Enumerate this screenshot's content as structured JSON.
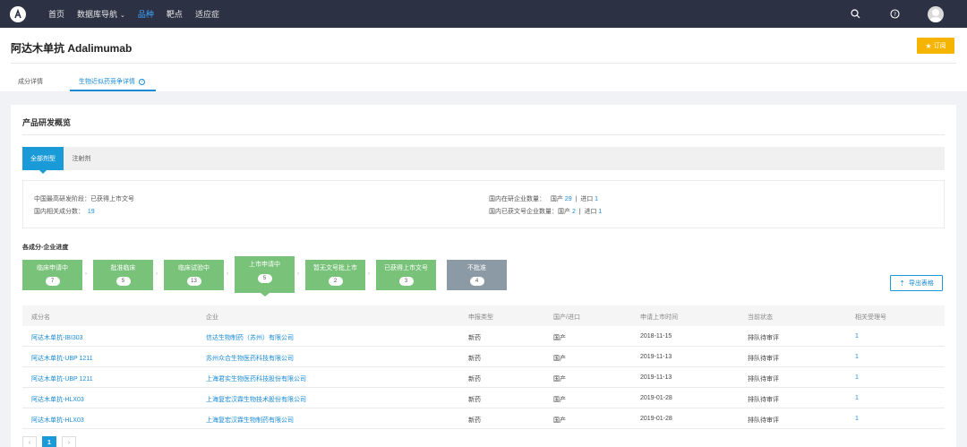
{
  "topbar": {
    "home": "首页",
    "db_nav": "数据库导航",
    "tabs": [
      "品种",
      "靶点",
      "适应症"
    ]
  },
  "header": {
    "title": "阿达木单抗 Adalimumab",
    "subscribe": "订阅",
    "tabs": [
      "成分详情",
      "生物近似药竞争详情"
    ]
  },
  "overview": {
    "title": "产品研发概览",
    "type_tabs": [
      "全部剂型",
      "注射剂"
    ],
    "info": {
      "highest_stage_label": "中国最高研发阶段：",
      "highest_stage_value": "已获得上市文号",
      "related_count_label": "国内相关成分数：",
      "related_count_value": "19",
      "in_dev_label": "国内在研企业数量：",
      "in_dev_domestic_label": "国产",
      "in_dev_domestic_value": "29",
      "in_dev_import_label": "进口",
      "in_dev_import_value": "1",
      "approved_label": "国内已获文号企业数量：",
      "approved_domestic_label": "国产",
      "approved_domestic_value": "2",
      "approved_import_label": "进口",
      "approved_import_value": "1",
      "sep": "|"
    },
    "progress_title": "各成分-企业进度",
    "stages": [
      {
        "label": "临床申请中",
        "count": "7"
      },
      {
        "label": "批准临床",
        "count": "5"
      },
      {
        "label": "临床试验中",
        "count": "13"
      },
      {
        "label": "上市申请中",
        "count": "5"
      },
      {
        "label": "暂无文号批上市",
        "count": "2"
      },
      {
        "label": "已获得上市文号",
        "count": "3"
      },
      {
        "label": "不批准",
        "count": "4"
      }
    ],
    "export": "导出表格"
  },
  "table": {
    "headers": [
      "成分名",
      "企业",
      "申报类型",
      "国产/进口",
      "申请上市时间",
      "当前状态",
      "相关受理号"
    ],
    "rows": [
      [
        "阿达木单抗-IBI303",
        "信达生物制药（苏州）有限公司",
        "新药",
        "国产",
        "2018-11-15",
        "排队待审评",
        "1"
      ],
      [
        "阿达木单抗-UBP 1211",
        "苏州众合生物医药科技有限公司",
        "新药",
        "国产",
        "2019-11-13",
        "排队待审评",
        "1"
      ],
      [
        "阿达木单抗-UBP 1211",
        "上海君实生物医药科技股份有限公司",
        "新药",
        "国产",
        "2019-11-13",
        "排队待审评",
        "1"
      ],
      [
        "阿达木单抗-HLX03",
        "上海复宏汉霖生物技术股份有限公司",
        "新药",
        "国产",
        "2019-01-28",
        "排队待审评",
        "1"
      ],
      [
        "阿达木单抗-HLX03",
        "上海复宏汉霖生物制药有限公司",
        "新药",
        "国产",
        "2019-01-28",
        "排队待审评",
        "1"
      ]
    ]
  },
  "pager": {
    "prev": "‹",
    "current": "1",
    "next": "›"
  }
}
